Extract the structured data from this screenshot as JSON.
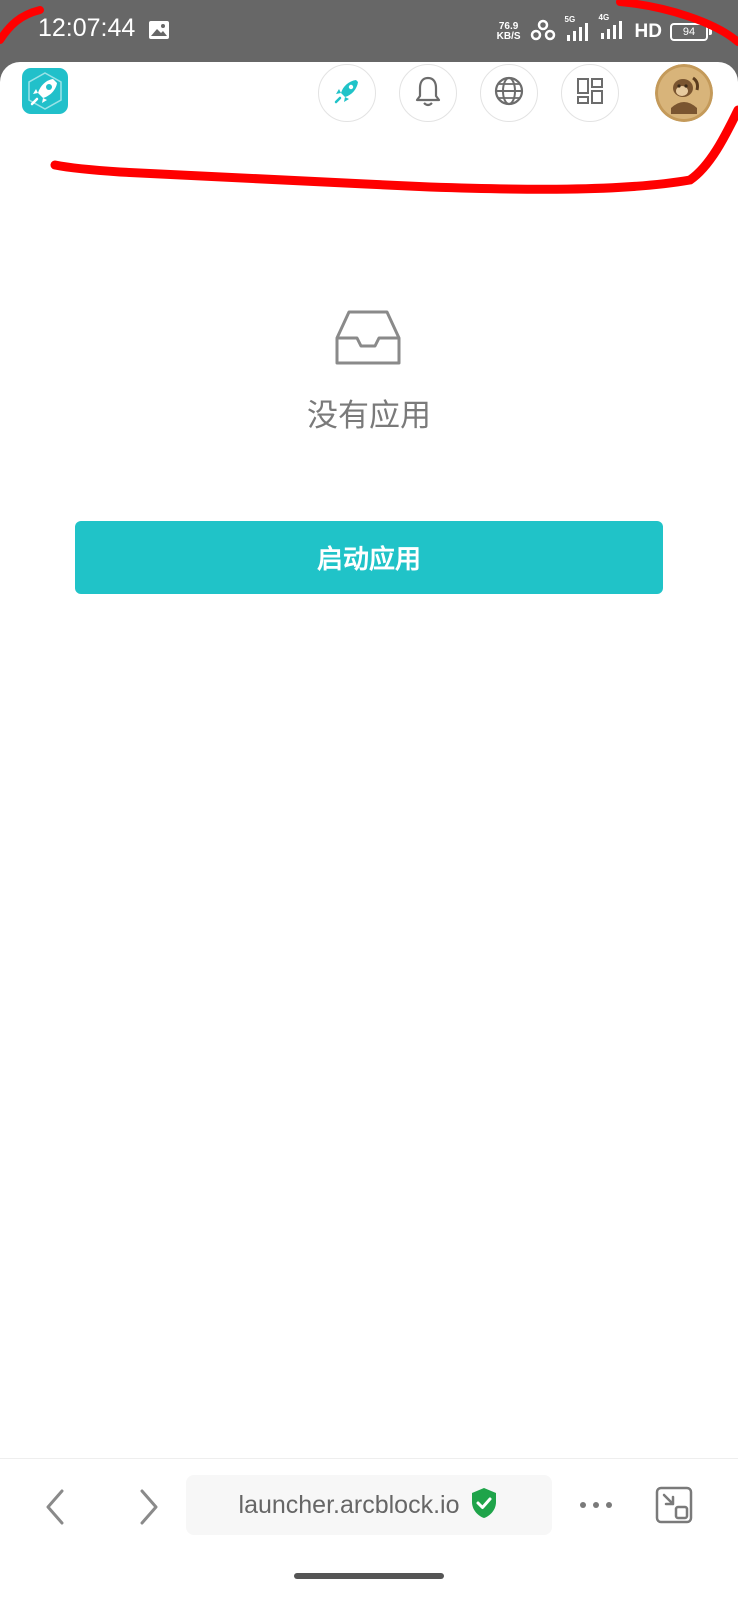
{
  "status_bar": {
    "time": "12:07:44",
    "net_speed_value": "76.9",
    "net_speed_unit": "KB/S",
    "signal_5g_label": "5G",
    "signal_4g_label": "4G",
    "hd_label": "HD",
    "battery_level": "94"
  },
  "header": {
    "logo_icon": "rocket-logo-icon",
    "buttons": [
      {
        "name": "launch-button",
        "icon": "rocket-icon"
      },
      {
        "name": "notifications-button",
        "icon": "bell-icon"
      },
      {
        "name": "language-button",
        "icon": "globe-icon"
      },
      {
        "name": "apps-button",
        "icon": "grid-icon"
      }
    ],
    "avatar": "user-avatar"
  },
  "empty_state": {
    "icon": "inbox-icon",
    "text": "没有应用"
  },
  "launch_button": {
    "label": "启动应用"
  },
  "browser_bar": {
    "url": "launcher.arcblock.io",
    "secure_icon": "shield-check-icon"
  },
  "colors": {
    "accent": "#20c3c8",
    "secure": "#1fa44a",
    "status_bg": "#676767",
    "annotation": "#ff0000"
  }
}
